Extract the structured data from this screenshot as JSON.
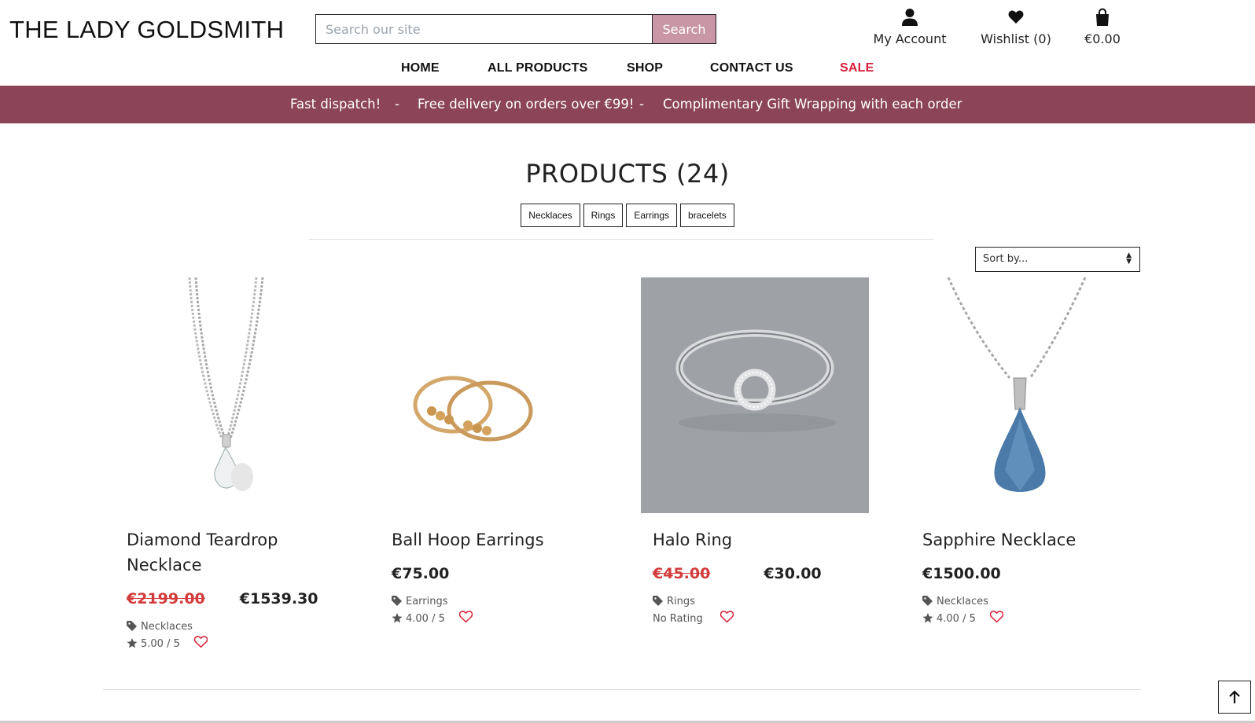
{
  "brand": {
    "logo": "THE LADY GOLDSMITH"
  },
  "search": {
    "placeholder": "Search our site",
    "button": "Search"
  },
  "header_links": {
    "account": {
      "label": "My Account",
      "icon": "user-icon"
    },
    "wishlist": {
      "label": "Wishlist (0)",
      "icon": "heart-icon"
    },
    "bag": {
      "label": "€0.00",
      "icon": "shopping-bag-icon"
    }
  },
  "nav": {
    "home": "HOME",
    "all_products": "ALL PRODUCTS",
    "shop": "SHOP",
    "contact": "CONTACT US",
    "sale": "SALE"
  },
  "promo": {
    "item1": "Fast dispatch!",
    "sep1": "-",
    "item2": "Free delivery on orders over €99!",
    "sep2": "-",
    "item3": "Complimentary Gift Wrapping with each order"
  },
  "page": {
    "title": "PRODUCTS (24)",
    "categories": [
      "Necklaces",
      "Rings",
      "Earrings",
      "bracelets"
    ],
    "sort_label": "Sort by..."
  },
  "products": [
    {
      "name": "Diamond Teardrop Necklace",
      "old_price": "€2199.00",
      "price": "€1539.30",
      "category": "Necklaces",
      "rating": "5.00 / 5"
    },
    {
      "name": "Ball Hoop Earrings",
      "price": "€75.00",
      "category": "Earrings",
      "rating": "4.00 / 5"
    },
    {
      "name": "Halo Ring",
      "old_price": "€45.00",
      "price": "€30.00",
      "category": "Rings",
      "rating": "No Rating"
    },
    {
      "name": "Sapphire Necklace",
      "price": "€1500.00",
      "category": "Necklaces",
      "rating": "4.00 / 5"
    }
  ],
  "colors": {
    "promo_bar": "#8b4556",
    "search_button": "#c996a6",
    "sale": "#d6203a",
    "old_price": "#d33b3b",
    "heart": "#d6203a"
  }
}
